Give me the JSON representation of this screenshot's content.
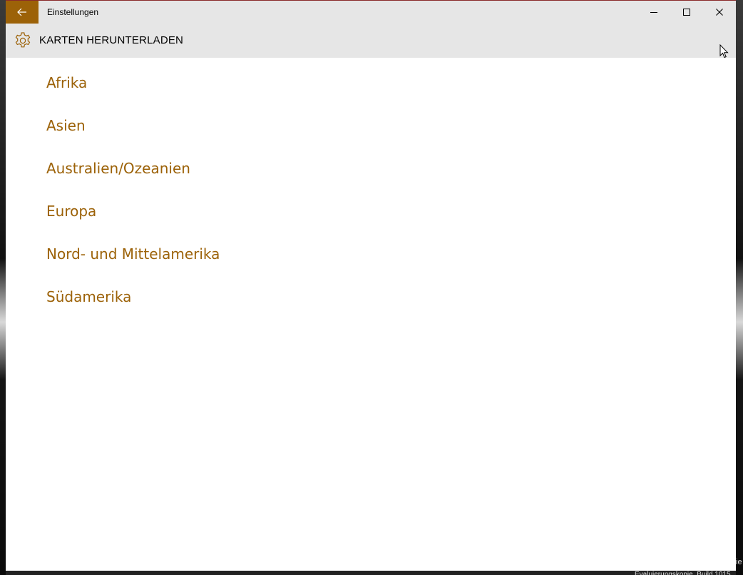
{
  "window": {
    "title": "Einstellungen",
    "accent_color": "#9c6208"
  },
  "titlebar": {
    "back_icon": "arrow-left-icon",
    "minimize_icon": "minimize-icon",
    "maximize_icon": "maximize-icon",
    "close_icon": "close-icon"
  },
  "header": {
    "icon": "gear-icon",
    "title": "KARTEN HERUNTERLADEN"
  },
  "regions": [
    {
      "label": "Afrika"
    },
    {
      "label": "Asien"
    },
    {
      "label": "Australien/Ozeanien"
    },
    {
      "label": "Europa"
    },
    {
      "label": "Nord- und Mittelamerika"
    },
    {
      "label": "Südamerika"
    }
  ],
  "desktop": {
    "status_text": "Evaluierungskopie. Build 1015",
    "edge_text": "ie"
  }
}
